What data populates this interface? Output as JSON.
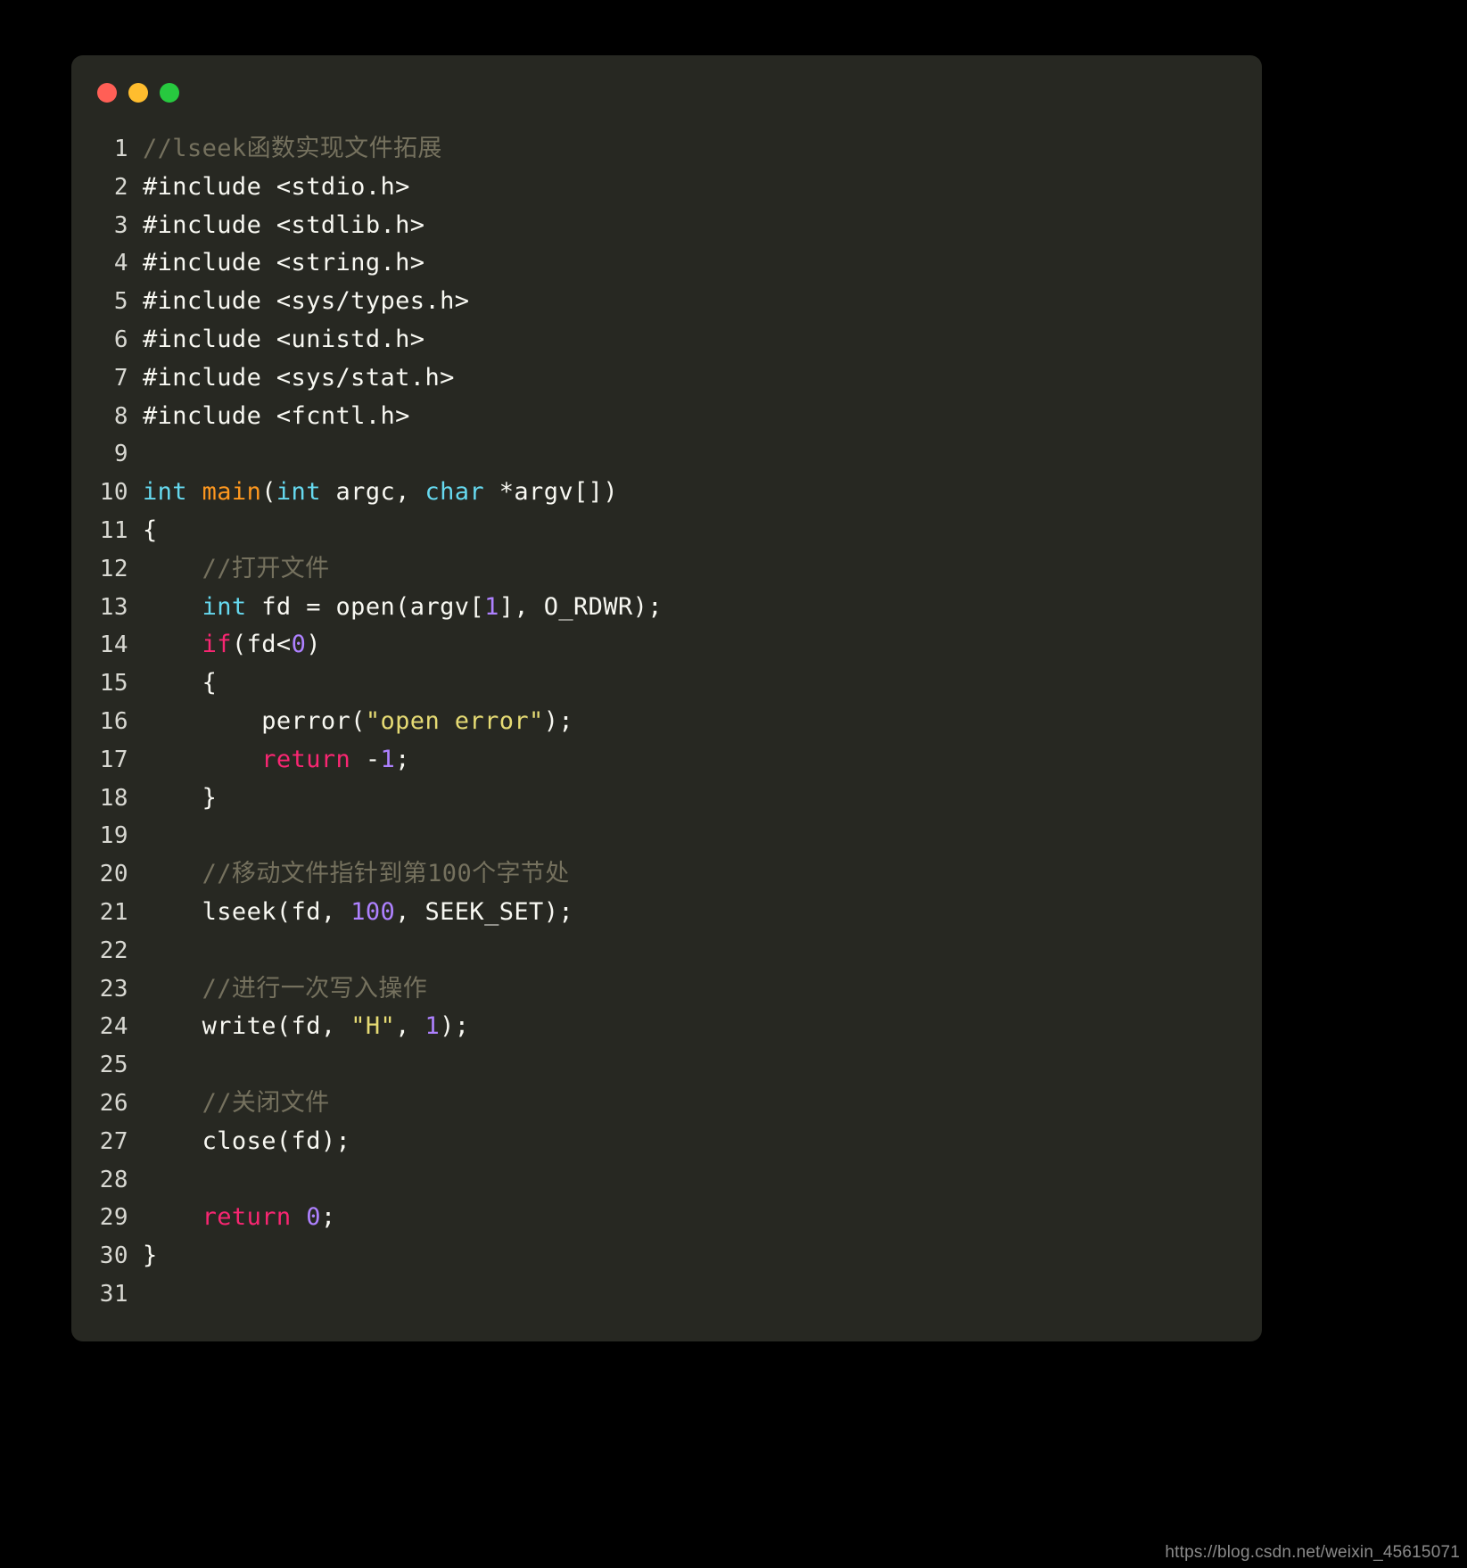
{
  "window": {
    "title_bar": {
      "buttons": [
        {
          "name": "close-button",
          "color": "#ff5f56"
        },
        {
          "name": "minimize-button",
          "color": "#ffbd2e"
        },
        {
          "name": "maximize-button",
          "color": "#27c93f"
        }
      ]
    },
    "background": "#272822"
  },
  "editor": {
    "language": "C",
    "theme_colors": {
      "background": "#272822",
      "foreground": "#f8f8f2",
      "comment": "#75715e",
      "keyword": "#f92672",
      "type": "#66d9ef",
      "function": "#fd971f",
      "number": "#ae81ff",
      "string": "#e6db74",
      "line_number": "#d8d8d2"
    },
    "lines": [
      {
        "num": "1",
        "tokens": [
          {
            "t": "//lseek函数实现文件拓展",
            "c": "comment"
          }
        ]
      },
      {
        "num": "2",
        "tokens": [
          {
            "t": "#include <stdio.h>",
            "c": "plain"
          }
        ]
      },
      {
        "num": "3",
        "tokens": [
          {
            "t": "#include <stdlib.h>",
            "c": "plain"
          }
        ]
      },
      {
        "num": "4",
        "tokens": [
          {
            "t": "#include <string.h>",
            "c": "plain"
          }
        ]
      },
      {
        "num": "5",
        "tokens": [
          {
            "t": "#include <sys/types.h>",
            "c": "plain"
          }
        ]
      },
      {
        "num": "6",
        "tokens": [
          {
            "t": "#include <unistd.h>",
            "c": "plain"
          }
        ]
      },
      {
        "num": "7",
        "tokens": [
          {
            "t": "#include <sys/stat.h>",
            "c": "plain"
          }
        ]
      },
      {
        "num": "8",
        "tokens": [
          {
            "t": "#include <fcntl.h>",
            "c": "plain"
          }
        ]
      },
      {
        "num": "9",
        "tokens": []
      },
      {
        "num": "10",
        "tokens": [
          {
            "t": "int",
            "c": "type"
          },
          {
            "t": " ",
            "c": "plain"
          },
          {
            "t": "main",
            "c": "fn"
          },
          {
            "t": "(",
            "c": "plain"
          },
          {
            "t": "int",
            "c": "type"
          },
          {
            "t": " argc, ",
            "c": "plain"
          },
          {
            "t": "char",
            "c": "type"
          },
          {
            "t": " *argv[])",
            "c": "plain"
          }
        ]
      },
      {
        "num": "11",
        "tokens": [
          {
            "t": "{",
            "c": "plain"
          }
        ]
      },
      {
        "num": "12",
        "tokens": [
          {
            "t": "    //打开文件",
            "c": "comment"
          }
        ]
      },
      {
        "num": "13",
        "tokens": [
          {
            "t": "    ",
            "c": "plain"
          },
          {
            "t": "int",
            "c": "type"
          },
          {
            "t": " fd = open(argv[",
            "c": "plain"
          },
          {
            "t": "1",
            "c": "num"
          },
          {
            "t": "], O_RDWR);",
            "c": "plain"
          }
        ]
      },
      {
        "num": "14",
        "tokens": [
          {
            "t": "    ",
            "c": "plain"
          },
          {
            "t": "if",
            "c": "key"
          },
          {
            "t": "(fd<",
            "c": "plain"
          },
          {
            "t": "0",
            "c": "num"
          },
          {
            "t": ")",
            "c": "plain"
          }
        ]
      },
      {
        "num": "15",
        "tokens": [
          {
            "t": "    {",
            "c": "plain"
          }
        ]
      },
      {
        "num": "16",
        "tokens": [
          {
            "t": "        perror(",
            "c": "plain"
          },
          {
            "t": "\"open error\"",
            "c": "str"
          },
          {
            "t": ");",
            "c": "plain"
          }
        ]
      },
      {
        "num": "17",
        "tokens": [
          {
            "t": "        ",
            "c": "plain"
          },
          {
            "t": "return",
            "c": "key"
          },
          {
            "t": " -",
            "c": "plain"
          },
          {
            "t": "1",
            "c": "num"
          },
          {
            "t": ";",
            "c": "plain"
          }
        ]
      },
      {
        "num": "18",
        "tokens": [
          {
            "t": "    }",
            "c": "plain"
          }
        ]
      },
      {
        "num": "19",
        "tokens": []
      },
      {
        "num": "20",
        "tokens": [
          {
            "t": "    //移动文件指针到第100个字节处",
            "c": "comment"
          }
        ]
      },
      {
        "num": "21",
        "tokens": [
          {
            "t": "    lseek(fd, ",
            "c": "plain"
          },
          {
            "t": "100",
            "c": "num"
          },
          {
            "t": ", SEEK_SET);",
            "c": "plain"
          }
        ]
      },
      {
        "num": "22",
        "tokens": []
      },
      {
        "num": "23",
        "tokens": [
          {
            "t": "    //进行一次写入操作",
            "c": "comment"
          }
        ]
      },
      {
        "num": "24",
        "tokens": [
          {
            "t": "    write(fd, ",
            "c": "plain"
          },
          {
            "t": "\"H\"",
            "c": "str"
          },
          {
            "t": ", ",
            "c": "plain"
          },
          {
            "t": "1",
            "c": "num"
          },
          {
            "t": ");",
            "c": "plain"
          }
        ]
      },
      {
        "num": "25",
        "tokens": []
      },
      {
        "num": "26",
        "tokens": [
          {
            "t": "    //关闭文件",
            "c": "comment"
          }
        ]
      },
      {
        "num": "27",
        "tokens": [
          {
            "t": "    close(fd);",
            "c": "plain"
          }
        ]
      },
      {
        "num": "28",
        "tokens": []
      },
      {
        "num": "29",
        "tokens": [
          {
            "t": "    ",
            "c": "plain"
          },
          {
            "t": "return",
            "c": "key"
          },
          {
            "t": " ",
            "c": "plain"
          },
          {
            "t": "0",
            "c": "num"
          },
          {
            "t": ";",
            "c": "plain"
          }
        ]
      },
      {
        "num": "30",
        "tokens": [
          {
            "t": "}",
            "c": "plain"
          }
        ]
      },
      {
        "num": "31",
        "tokens": []
      }
    ]
  },
  "watermark": {
    "text": "https://blog.csdn.net/weixin_45615071"
  }
}
